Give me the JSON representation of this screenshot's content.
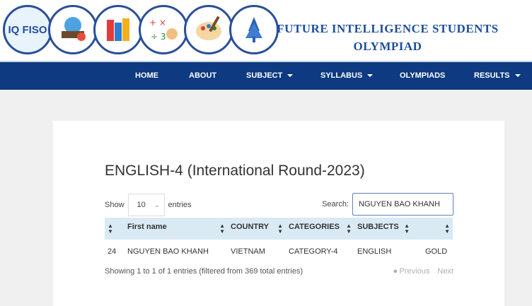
{
  "header": {
    "logo_text": "IQ FISO",
    "title_line1": "FUTURE INTELLIGENCE STUDENTS",
    "title_line2": "OLYMPIAD",
    "logo_icons": [
      "iq-fiso-logo-icon",
      "science-icon",
      "books-icon",
      "math-icon",
      "art-palette-icon",
      "tree-people-icon"
    ]
  },
  "nav": {
    "items": [
      {
        "label": "HOME",
        "dropdown": false
      },
      {
        "label": "ABOUT",
        "dropdown": false
      },
      {
        "label": "SUBJECT",
        "dropdown": true
      },
      {
        "label": "SYLLABUS",
        "dropdown": true
      },
      {
        "label": "OLYMPIADS",
        "dropdown": false
      },
      {
        "label": "RESULTS",
        "dropdown": true
      }
    ]
  },
  "content": {
    "title": "ENGLISH-4 (International Round-2023)",
    "show_label": "Show",
    "entries_value": "10",
    "entries_label": "entries",
    "search_label": "Search:",
    "search_value": "NGUYEN BAO KHANH",
    "columns": [
      "",
      "First name",
      "COUNTRY",
      "CATEGORIES",
      "SUBJECTS",
      ""
    ],
    "rows": [
      [
        "24",
        "NGUYEN BAO KHANH",
        "VIETNAM",
        "CATEGORY-4",
        "ENGLISH",
        "GOLD"
      ]
    ],
    "info": "Showing 1 to 1 of 1 entries (filtered from 369 total entries)",
    "prev_label": "Previous",
    "next_label": "Next"
  },
  "colors": {
    "navbar": "#0d3a80",
    "title_blue": "#1e4e9a",
    "table_header": "#d9eaf5"
  }
}
